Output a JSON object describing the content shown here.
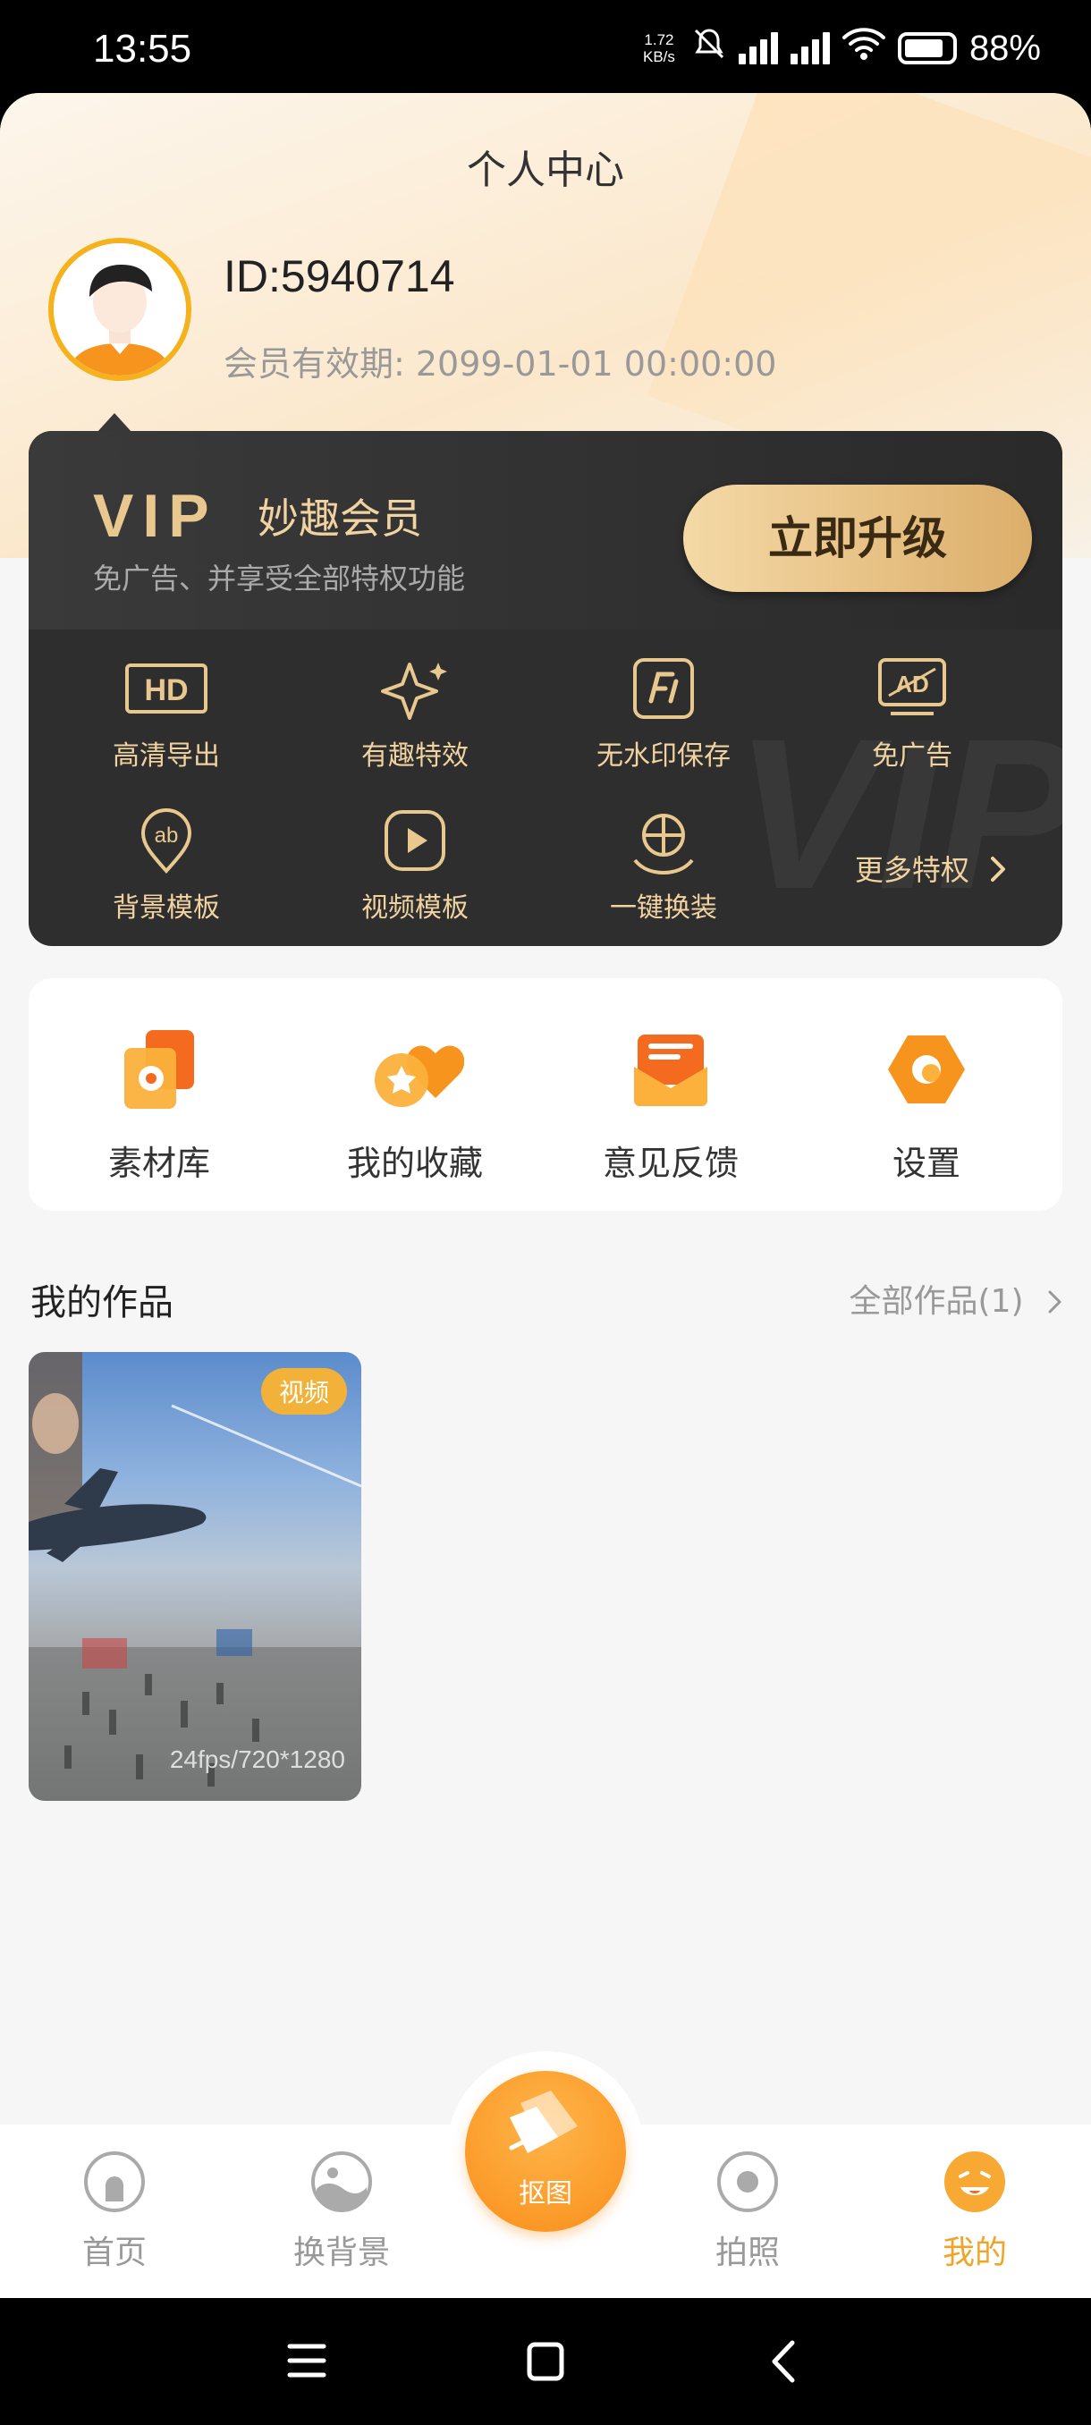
{
  "status_bar": {
    "time": "13:55",
    "net_speed_value": "1.72",
    "net_speed_unit": "KB/s",
    "battery": "88%"
  },
  "header": {
    "title": "个人中心"
  },
  "user": {
    "id": "ID:5940714",
    "expiry": "会员有效期: 2099-01-01 00:00:00"
  },
  "vip": {
    "logo": "VIP",
    "name": "妙趣会员",
    "subtitle": "免广告、并享受全部特权功能",
    "upgrade_label": "立即升级",
    "watermark": "VIP",
    "perks": [
      {
        "label": "高清导出",
        "icon": "hd-icon"
      },
      {
        "label": "有趣特效",
        "icon": "sparkle-icon"
      },
      {
        "label": "无水印保存",
        "icon": "no-watermark-icon"
      },
      {
        "label": "免广告",
        "icon": "ad-free-icon"
      },
      {
        "label": "背景模板",
        "icon": "background-template-icon"
      },
      {
        "label": "视频模板",
        "icon": "video-template-icon"
      },
      {
        "label": "一键换装",
        "icon": "outfit-swap-icon"
      }
    ],
    "more_label": "更多特权",
    "accent_color": "#f0d3a0"
  },
  "tools": [
    {
      "label": "素材库",
      "icon": "material-library-icon"
    },
    {
      "label": "我的收藏",
      "icon": "favorites-icon"
    },
    {
      "label": "意见反馈",
      "icon": "feedback-icon"
    },
    {
      "label": "设置",
      "icon": "settings-icon"
    }
  ],
  "works": {
    "title": "我的作品",
    "all_label": "全部作品(1)",
    "items": [
      {
        "badge": "视频",
        "meta": "24fps/720*1280"
      }
    ]
  },
  "bottom_nav": {
    "items": [
      {
        "label": "首页",
        "icon": "home-icon"
      },
      {
        "label": "换背景",
        "icon": "change-background-icon"
      },
      {
        "label": "拍照",
        "icon": "camera-icon"
      },
      {
        "label": "我的",
        "icon": "profile-icon",
        "active": true
      }
    ],
    "center_label": "抠图",
    "accent_color": "#f0a52a"
  }
}
